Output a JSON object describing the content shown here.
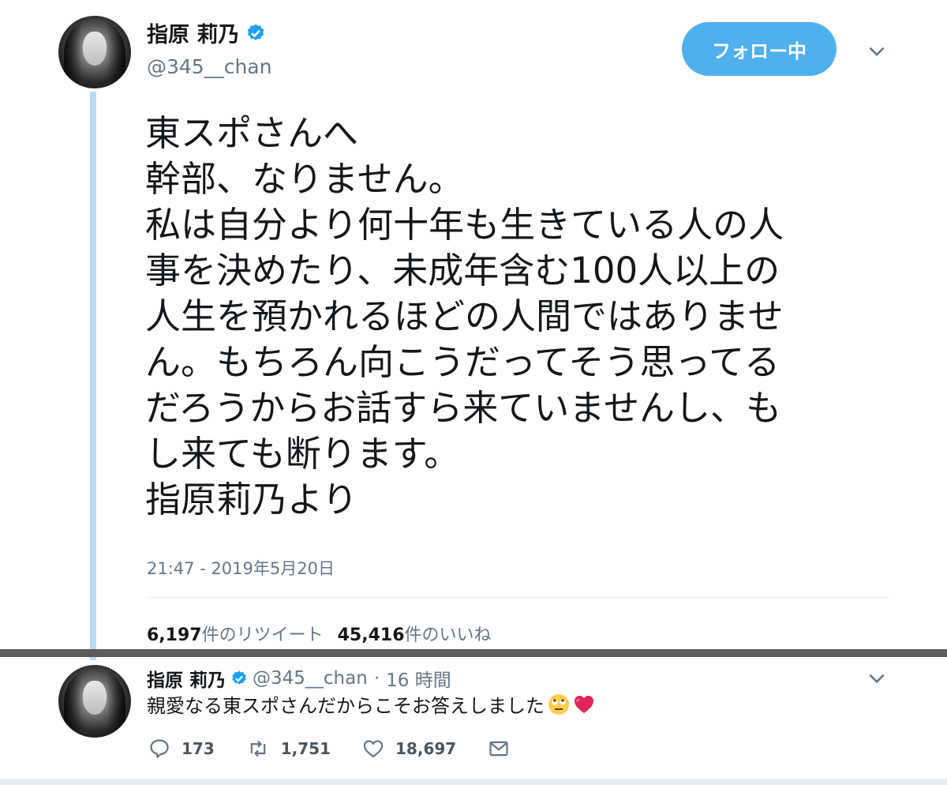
{
  "tweet": {
    "display_name": "指原 莉乃",
    "handle": "@345__chan",
    "follow_label": "フォロー中",
    "text_lines": [
      "東スポさんへ",
      "幹部、なりません。",
      "私は自分より何十年も生きている人の人",
      "事を決めたり、未成年含む100人以上の",
      "人生を預かれるほどの人間ではありませ",
      "ん。もちろん向こうだってそう思ってる",
      "だろうからお話すら来ていませんし、も",
      "し来ても断ります。",
      "指原莉乃より"
    ],
    "timestamp": "21:47 - 2019年5月20日",
    "retweets_count": "6,197",
    "retweets_label": "件のリツイート",
    "likes_count": "45,416",
    "likes_label": "件のいいね"
  },
  "reply": {
    "display_name": "指原 莉乃",
    "handle": "@345__chan",
    "separator": "·",
    "time": "16 時間",
    "text": "親愛なる東スポさんだからこそお答えしました",
    "emojis": [
      "face-with-rolling-eyes",
      "heart"
    ],
    "replies": "173",
    "retweets": "1,751",
    "likes": "18,697"
  },
  "colors": {
    "accent": "#4fb0ee",
    "thread_line": "#b8dcf5",
    "secondary_text": "#657786",
    "separator_bar": "#5c5c5c"
  },
  "icons": [
    "verified-badge-icon",
    "chevron-down-icon",
    "reply-icon",
    "retweet-icon",
    "like-icon",
    "dm-icon"
  ]
}
